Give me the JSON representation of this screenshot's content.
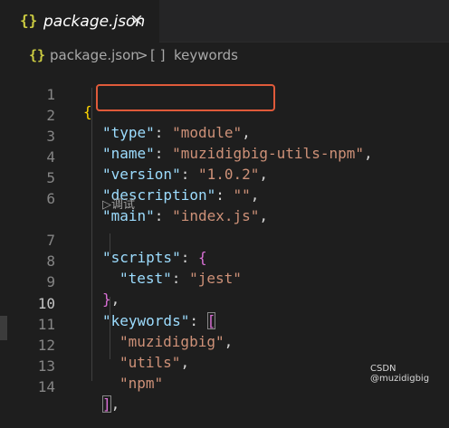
{
  "tab": {
    "icon": "{}",
    "label": "package.json",
    "close": "×"
  },
  "breadcrumb": {
    "file_icon": "{}",
    "file": "package.json",
    "separator": ">",
    "symbol_icon": "[ ]",
    "symbol": "keywords"
  },
  "codelens": "▷调试",
  "lines": [
    {
      "n": "1"
    },
    {
      "n": "2"
    },
    {
      "n": "3"
    },
    {
      "n": "4"
    },
    {
      "n": "5"
    },
    {
      "n": "6"
    },
    {
      "n": "7"
    },
    {
      "n": "8"
    },
    {
      "n": "9"
    },
    {
      "n": "10"
    },
    {
      "n": "11"
    },
    {
      "n": "12"
    },
    {
      "n": "13"
    },
    {
      "n": "14"
    }
  ],
  "json": {
    "key_type": "\"type\"",
    "val_type": "\"module\"",
    "key_name": "\"name\"",
    "val_name": "\"muzidigbig-utils-npm\"",
    "key_version": "\"version\"",
    "val_version": "\"1.0.2\"",
    "key_description": "\"description\"",
    "val_description": "\"\"",
    "key_main": "\"main\"",
    "val_main": "\"index.js\"",
    "key_scripts": "\"scripts\"",
    "key_test": "\"test\"",
    "val_test": "\"jest\"",
    "key_keywords": "\"keywords\"",
    "kw1": "\"muzidigbig\"",
    "kw2": "\"utils\"",
    "kw3": "\"npm\""
  },
  "watermark": "CSDN @muzidigbig",
  "colors": {
    "key": "#9cdcfe",
    "string": "#ce9178",
    "bracket_gold": "#ffd700",
    "bracket_purple": "#da70d6",
    "highlight": "#e05a3a"
  }
}
